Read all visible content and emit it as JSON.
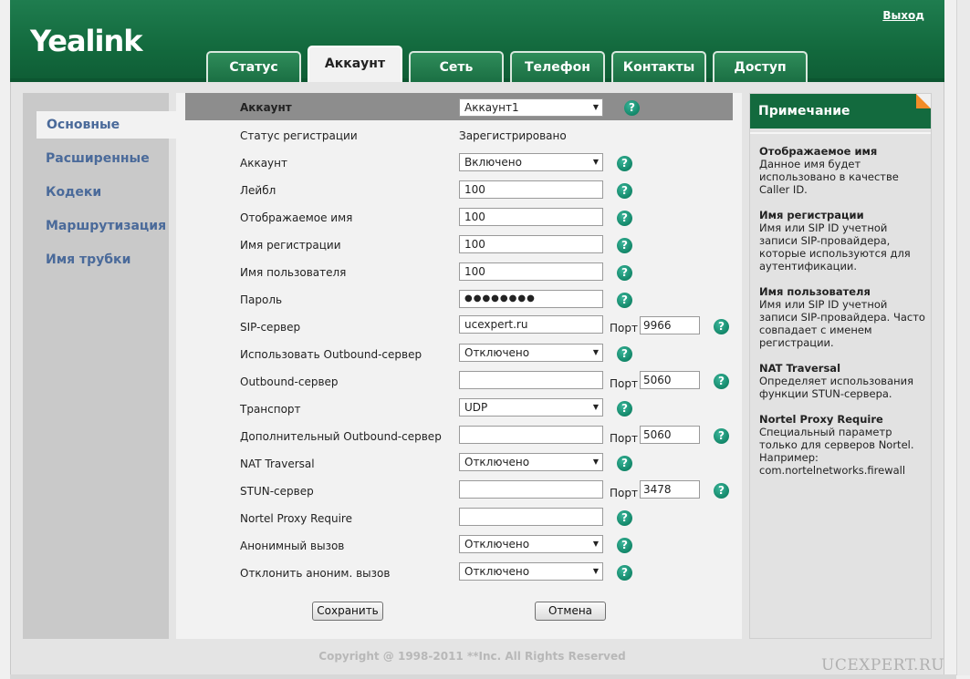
{
  "header": {
    "logo": "Yealink",
    "logout": "Выход",
    "tabs": [
      "Статус",
      "Аккаунт",
      "Сеть",
      "Телефон",
      "Контакты",
      "Доступ"
    ]
  },
  "sidebar": {
    "items": [
      "Основные",
      "Расширенные",
      "Кодеки",
      "Маршрутизация",
      "Имя трубки"
    ]
  },
  "form": {
    "account_label": "Аккаунт",
    "account_value": "Аккаунт1",
    "rows": [
      {
        "label": "Статус регистрации",
        "value": "Зарегистрировано"
      },
      {
        "label": "Аккаунт",
        "value": "Включено"
      },
      {
        "label": "Лейбл",
        "value": "100"
      },
      {
        "label": "Отображаемое имя",
        "value": "100"
      },
      {
        "label": "Имя регистрации",
        "value": "100"
      },
      {
        "label": "Имя пользователя",
        "value": "100"
      },
      {
        "label": "Пароль",
        "value": "●●●●●●●●"
      },
      {
        "label": "SIP-сервер",
        "value": "ucexpert.ru",
        "port": "9966"
      },
      {
        "label": "Использовать Outbound-сервер",
        "value": "Отключено"
      },
      {
        "label": "Outbound-сервер",
        "value": "",
        "port": "5060"
      },
      {
        "label": "Транспорт",
        "value": "UDP"
      },
      {
        "label": "Дополнительный Outbound-сервер",
        "value": "",
        "port": "5060"
      },
      {
        "label": "NAT Traversal",
        "value": "Отключено"
      },
      {
        "label": "STUN-сервер",
        "value": "",
        "port": "3478"
      },
      {
        "label": "Nortel Proxy Require",
        "value": ""
      },
      {
        "label": "Анонимный вызов",
        "value": "Отключено"
      },
      {
        "label": "Отклонить аноним. вызов",
        "value": "Отключено"
      }
    ],
    "port_label": "Порт",
    "help_glyph": "?",
    "save": "Сохранить",
    "cancel": "Отмена"
  },
  "note": {
    "title": "Примечание",
    "items": [
      {
        "title": "Отображаемое имя",
        "text": "Данное имя будет использовано в качестве Caller ID."
      },
      {
        "title": "Имя регистрации",
        "text": "Имя или SIP ID учетной записи SIP-провайдера, которые используются для аутентификации."
      },
      {
        "title": "Имя пользователя",
        "text": "Имя или SIP ID учетной записи SIP-провайдера. Часто совпадает с именем регистрации."
      },
      {
        "title": "NAT Traversal",
        "text": "Определяет использования функции STUN-сервера."
      },
      {
        "title": "Nortel Proxy Require",
        "text": "Специальный параметр только для серверов Nortel. Например: com.nortelnetworks.firewall"
      }
    ]
  },
  "footer": {
    "copyright": "Copyright @ 1998-2011 **Inc. All Rights Reserved",
    "watermark": "UCEXPERT.RU"
  },
  "colors": {
    "header_green": "#136a3e",
    "help_teal": "#138769",
    "note_corner": "#f28c28",
    "sidebar_link": "#4a6a9a"
  }
}
